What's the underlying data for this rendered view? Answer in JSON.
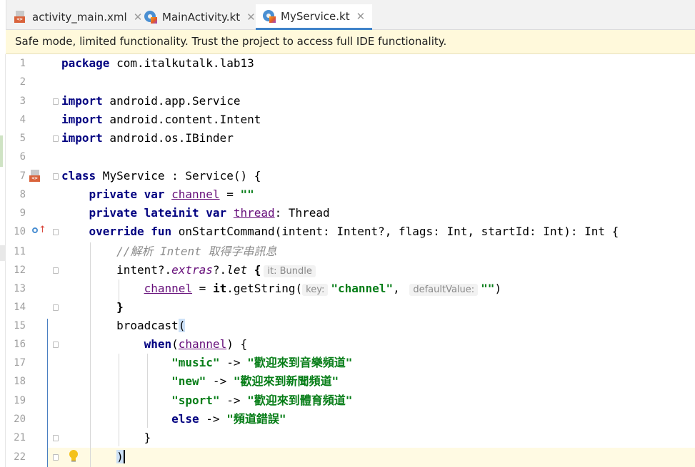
{
  "tabs": [
    {
      "label": "activity_main.xml",
      "icon": "xml-file-icon",
      "active": false
    },
    {
      "label": "MainActivity.kt",
      "icon": "kotlin-file-icon",
      "active": false
    },
    {
      "label": "MyService.kt",
      "icon": "kotlin-file-icon",
      "active": true
    }
  ],
  "banner": {
    "text": "Safe mode, limited functionality. Trust the project to access full IDE functionality."
  },
  "lines": {
    "l1": {
      "num": "1",
      "t1": "package",
      "t2": " com.italkutalk.lab13"
    },
    "l2": {
      "num": "2"
    },
    "l3": {
      "num": "3",
      "t1": "import",
      "t2": " android.app.Service"
    },
    "l4": {
      "num": "4",
      "t1": "import",
      "t2": " android.content.Intent"
    },
    "l5": {
      "num": "5",
      "t1": "import",
      "t2": " android.os.IBinder"
    },
    "l6": {
      "num": "6"
    },
    "l7": {
      "num": "7",
      "t1": "class",
      "t2": " MyService : Service() {"
    },
    "l8": {
      "num": "8",
      "t1": "    private var ",
      "t2": "channel",
      "t3": " = ",
      "t4": "\"\""
    },
    "l9": {
      "num": "9",
      "t1": "    private lateinit var ",
      "t2": "thread",
      "t3": ": Thread"
    },
    "l10": {
      "num": "10",
      "t1": "    override fun ",
      "t2": "onStartCommand(intent: Intent?, flags: Int, startId: Int): Int {"
    },
    "l11": {
      "num": "11",
      "t1": "        //解析 Intent 取得字串訊息"
    },
    "l12": {
      "num": "12",
      "t1": "        intent?.",
      "t2": "extras",
      "t3": "?.",
      "t4": "let",
      "t5": " {",
      "hint": "it: Bundle"
    },
    "l13": {
      "num": "13",
      "t1": "            ",
      "t2": "channel",
      "t3": " = ",
      "t4": "it",
      "t5": ".getString(",
      "hint1": "key:",
      "s1": "\"channel\"",
      "t6": ", ",
      "hint2": "defaultValue:",
      "s2": "\"\"",
      "t7": ")"
    },
    "l14": {
      "num": "14",
      "t1": "        }"
    },
    "l15": {
      "num": "15",
      "t1": "        broadcast",
      "t2": "("
    },
    "l16": {
      "num": "16",
      "t1": "            ",
      "t2": "when",
      "t3": "(",
      "t4": "channel",
      "t5": ") {"
    },
    "l17": {
      "num": "17",
      "t1": "                ",
      "s1": "\"music\"",
      "t2": " -> ",
      "s2": "\"歡迎來到音樂頻道\""
    },
    "l18": {
      "num": "18",
      "t1": "                ",
      "s1": "\"new\"",
      "t2": " -> ",
      "s2": "\"歡迎來到新聞頻道\""
    },
    "l19": {
      "num": "19",
      "t1": "                ",
      "s1": "\"sport\"",
      "t2": " -> ",
      "s2": "\"歡迎來到體育頻道\""
    },
    "l20": {
      "num": "20",
      "t1": "                ",
      "t2": "else",
      "t3": " -> ",
      "s1": "\"頻道錯誤\""
    },
    "l21": {
      "num": "21",
      "t1": "            }"
    },
    "l22": {
      "num": "22",
      "t1": "        ",
      "t2": ")"
    }
  },
  "colors": {
    "keyword": "#000080",
    "string": "#067d17",
    "property": "#660e7a",
    "comment": "#8c8c8c",
    "current_line": "#fffae3",
    "banner": "#fff9db"
  }
}
